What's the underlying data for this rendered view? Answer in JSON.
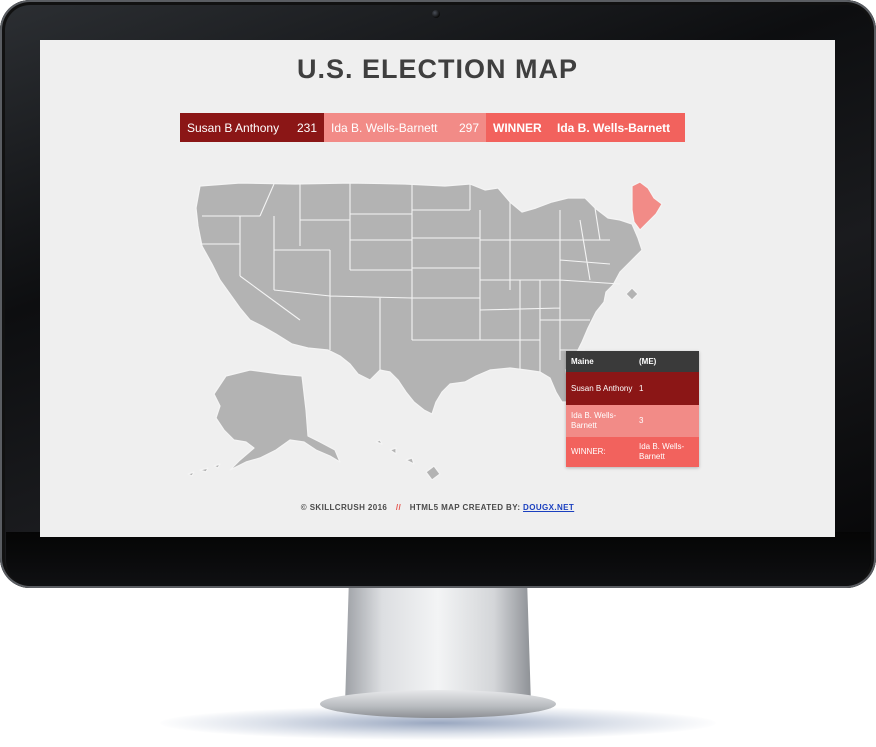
{
  "page": {
    "title": "U.S. ELECTION MAP"
  },
  "results": {
    "candidate_a": {
      "name": "Susan B Anthony",
      "votes": "231",
      "color": "#8b1616"
    },
    "candidate_b": {
      "name": "Ida B. Wells-Barnett",
      "votes": "297",
      "color": "#f28b87"
    },
    "winner": {
      "label": "WINNER",
      "name": "Ida B. Wells-Barnett",
      "color": "#f2625d"
    }
  },
  "map": {
    "default_state_color": "#b3b3b3",
    "highlighted_state": "Maine",
    "highlighted_color": "#f28b87"
  },
  "state_info": {
    "state": "Maine",
    "abbr": "(ME)",
    "rows": [
      {
        "label": "Susan B Anthony",
        "value": "1"
      },
      {
        "label": "Ida B. Wells-Barnett",
        "value": "3"
      },
      {
        "label": "WINNER:",
        "value": "Ida B. Wells-Barnett"
      }
    ]
  },
  "footer": {
    "copyright": "© SKILLCRUSH 2016",
    "separator": "//",
    "credit": "HTML5 MAP CREATED BY:",
    "link": "DOUGX.NET"
  }
}
